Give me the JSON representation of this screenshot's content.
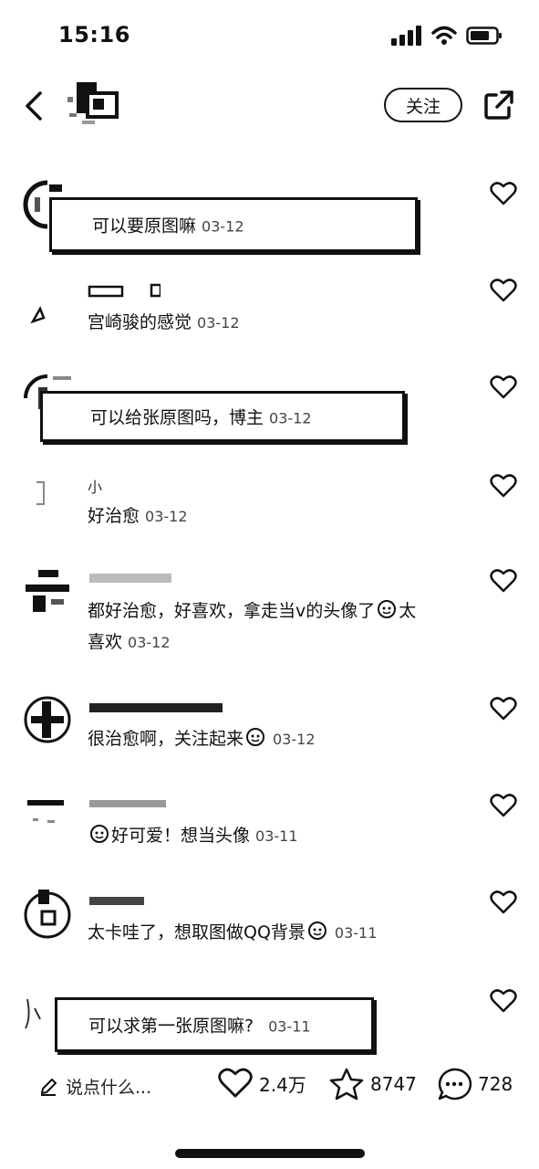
{
  "status_bar": {
    "time": "15:16"
  },
  "header": {
    "follow_label": "关注"
  },
  "comments": [
    {
      "username": "",
      "text": "可以要原图嘛",
      "date": "03-12"
    },
    {
      "username": "",
      "text": "宫崎骏的感觉",
      "date": "03-12"
    },
    {
      "username": "",
      "text": "可以给张原图吗，博主",
      "date": "03-12"
    },
    {
      "username": "小",
      "text": "好治愈",
      "date": "03-12"
    },
    {
      "username": "",
      "text_line1": "都好治愈，好喜欢，拿走当v的头像了",
      "text_after_emoji": "太",
      "text_line2": "喜欢",
      "date": "03-12"
    },
    {
      "username": "",
      "text": "很治愈啊，关注起来",
      "date": "03-12"
    },
    {
      "username": "",
      "text": "好可爱！想当头像",
      "date": "03-11"
    },
    {
      "username": "",
      "text": "太卡哇了，想取图做QQ背景",
      "date": "03-11"
    },
    {
      "username": "",
      "text": "可以求第一张原图嘛?",
      "date": "03-11"
    }
  ],
  "bottom_bar": {
    "input_placeholder": "说点什么...",
    "likes": "2.4万",
    "favorites": "8747",
    "comments_count": "728"
  },
  "icons": [
    "back-arrow-icon",
    "share-icon",
    "heart-icon",
    "star-icon",
    "comment-bubble-icon",
    "pencil-icon",
    "emoji-face-icon"
  ]
}
